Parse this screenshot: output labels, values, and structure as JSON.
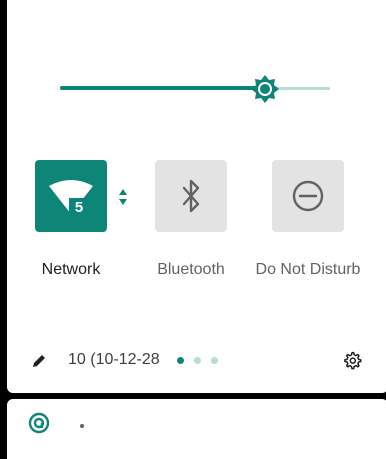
{
  "brightness": {
    "level_fraction": 0.76
  },
  "tiles": {
    "network": {
      "label": "Network",
      "badge": "5",
      "icon": "wifi-icon",
      "active": true
    },
    "bluetooth": {
      "label": "Bluetooth",
      "icon": "bluetooth-icon",
      "active": false
    },
    "dnd": {
      "label": "Do Not Disturb",
      "icon": "do-not-disturb-icon",
      "active": false
    }
  },
  "footer": {
    "build_text": "10 (10-12-28",
    "page_count": 3,
    "current_page": 1
  },
  "colors": {
    "accent": "#0d8577",
    "accent_light": "#b5dcd7",
    "tile_inactive": "#e3e3e3"
  }
}
